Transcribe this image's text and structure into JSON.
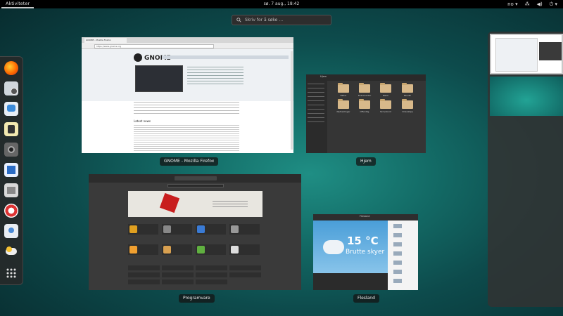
{
  "topbar": {
    "activities": "Aktiviteter",
    "clock": "sø. 7 aug., 18:42",
    "keyboard": "no"
  },
  "search": {
    "placeholder": "Skriv for å søke …"
  },
  "dash": {
    "apps": [
      "firefox-icon",
      "evolution-icon",
      "empathy-icon",
      "rhythmbox-icon",
      "shotwell-icon",
      "writer-icon",
      "files-icon",
      "help-icon",
      "software-icon",
      "weather-icon"
    ]
  },
  "windows": {
    "firefox": {
      "caption": "GNOME - Mozilla Firefox",
      "tab": "GNOME - Mozilla Firefox",
      "url": "https://www.gnome.org",
      "headline": "GNOME 3: Ease, comfort and control",
      "news": "Latest news"
    },
    "files": {
      "caption": "Hjem",
      "title": "Hjem",
      "folders": [
        "Bilder",
        "Dokumenter",
        "Maler",
        "Musikk",
        "Nedlastinger",
        "Offentlig",
        "Skrivebord",
        "Videoklipp"
      ]
    },
    "software": {
      "caption": "Programvare"
    },
    "weather": {
      "caption": "Flesland",
      "title": "Flesland",
      "temp": "15 °C",
      "condition": "Brutte skyer"
    }
  },
  "colors": {
    "topbar": "#000000",
    "bg_accent": "#1f8e84"
  }
}
